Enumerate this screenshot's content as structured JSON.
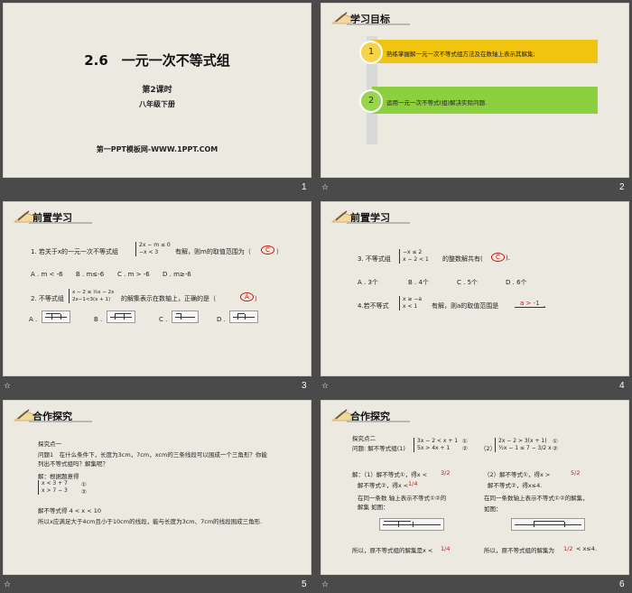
{
  "slides": [
    {
      "number": "1",
      "title": "2.6　一元一次不等式组",
      "lesson": "第2课时",
      "grade": "八年级下册",
      "footer": "第一PPT模板网-WWW.1PPT.COM"
    },
    {
      "number": "2",
      "header": "学习目标",
      "goals": [
        {
          "index": "1",
          "text": "熟练掌握解一元一次不等式组方法及在数轴上表示其解集;",
          "color": "#f1c40f"
        },
        {
          "index": "2",
          "text": "运用一元一次不等式(组)解决实际问题.",
          "color": "#8ccf3f"
        }
      ]
    },
    {
      "number": "3",
      "header": "前置学习",
      "q1_prefix": "1. 若关于x的一元一次不等式组",
      "q1_sys": [
        "2x − m ≤ 0",
        "−x < 3"
      ],
      "q1_suffix": "有解，则m的取值范围为（",
      "q1_answer": "C",
      "q1_close": "）",
      "q1_options": [
        "A . m < -6",
        "B . m≤-6",
        "C . m > -6",
        "D . m≥-6"
      ],
      "q2_prefix": "2. 不等式组",
      "q2_sys": [
        "x − 2 ≤ ½x − 2x",
        "2x−1<3(x + 1)"
      ],
      "q2_suffix": "的解集表示在数轴上，正确的是（",
      "q2_answer": "A",
      "q2_close": "）",
      "q2_options": [
        "A .",
        "B .",
        "C .",
        "D ."
      ]
    },
    {
      "number": "4",
      "header": "前置学习",
      "q3_prefix": "3. 不等式组",
      "q3_sys": [
        "−x ≤ 2",
        "x − 2 < 1"
      ],
      "q3_suffix": "的整数解共有(",
      "q3_answer": "C",
      "q3_close": ").",
      "q3_options": [
        "A . 3个",
        "B . 4个",
        "C . 5个",
        "D . 6个"
      ],
      "q4_prefix": "4.若不等式",
      "q4_sys": [
        "x ≥ −a",
        "x < 1"
      ],
      "q4_suffix": "有解，则a的取值范围是",
      "q4_answer": "a > -1",
      "q4_close": "."
    },
    {
      "number": "5",
      "header": "合作探究",
      "lines": [
        "探究点一",
        "问题1　在什么条件下，长度为3cm，7cm，xcm的三条线段可以围成一个三角形？你能",
        "列出不等式组吗？解集呢？",
        "解：根据题意得",
        "解不等式得  4 < x < 10",
        "所以x应满足大于4cm且小于10cm的线段，能与长度为3cm、7cm的线段围成三角形."
      ],
      "sys": [
        "x < 3 + 7",
        "x > 7 − 3"
      ],
      "tags": [
        "①",
        "②"
      ]
    },
    {
      "number": "6",
      "header": "合作探究",
      "left": [
        "探究点二",
        "问题: 解不等式组(1)",
        "解：（1）解不等式①，得x <",
        "解不等式②，得x <",
        "在同一条数 轴上表示不等式①②的",
        "解集 如图：",
        "所以，原不等式组的解集是x <"
      ],
      "left_sys": [
        "3x − 2 < x + 1",
        "5x > 4x + 1"
      ],
      "right": [
        "（2）",
        "（2）解不等式①，得x >",
        "解不等式②，得x≤4.",
        "在同一条数轴上表示不等式①②的解集，",
        "如图：",
        "所以，原不等式组的解集为",
        "< x≤4."
      ],
      "right_sys": [
        "2x − 2 > 3(x + 1)",
        "½x − 1 ≤ 7 − 3/2 x"
      ],
      "tags": [
        "①",
        "②"
      ],
      "fracs": [
        "3/2",
        "1/4",
        "5/2",
        "1/2"
      ]
    }
  ],
  "footer_icon": "star-icon",
  "footer_star_glyph": "☆"
}
